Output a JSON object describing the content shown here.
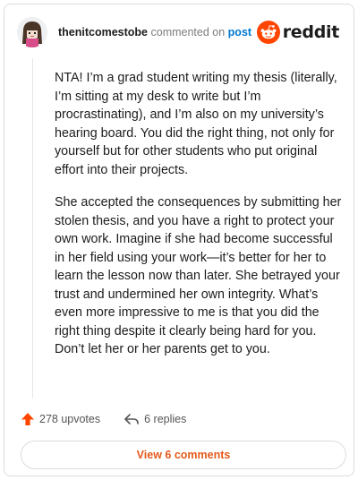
{
  "header": {
    "username": "thenitcomestobe",
    "action_text": "commented on",
    "post_link": "post",
    "brand": "reddit"
  },
  "comment": {
    "paragraphs": [
      "NTA! I’m a grad student writing my thesis (literally, I’m sitting at my desk to write but I’m procrastinating), and I’m also on my university’s hearing board. You did the right thing, not only for yourself but for other students who put original effort into their projects.",
      "She accepted the consequences by submitting her stolen thesis, and you have a right to protect your own work. Imagine if she had become successful in her field using your work—it’s better for her to learn the lesson now than later. She betrayed your trust and undermined her own integrity. What’s even more impressive to me is that you did the right thing despite it clearly being hard for you. Don’t let her or her parents get to you."
    ]
  },
  "actions": {
    "upvotes": "278 upvotes",
    "replies": "6 replies"
  },
  "footer": {
    "view_comments": "View 6 comments"
  },
  "colors": {
    "brand_orange": "#ff4500",
    "link_blue": "#0079d3",
    "view_comments_text": "#e45a1b"
  },
  "icons": {
    "avatar": "avatar-icon",
    "brand": "reddit-logo-icon",
    "upvote": "upvote-arrow-icon",
    "reply": "reply-arrow-icon"
  }
}
